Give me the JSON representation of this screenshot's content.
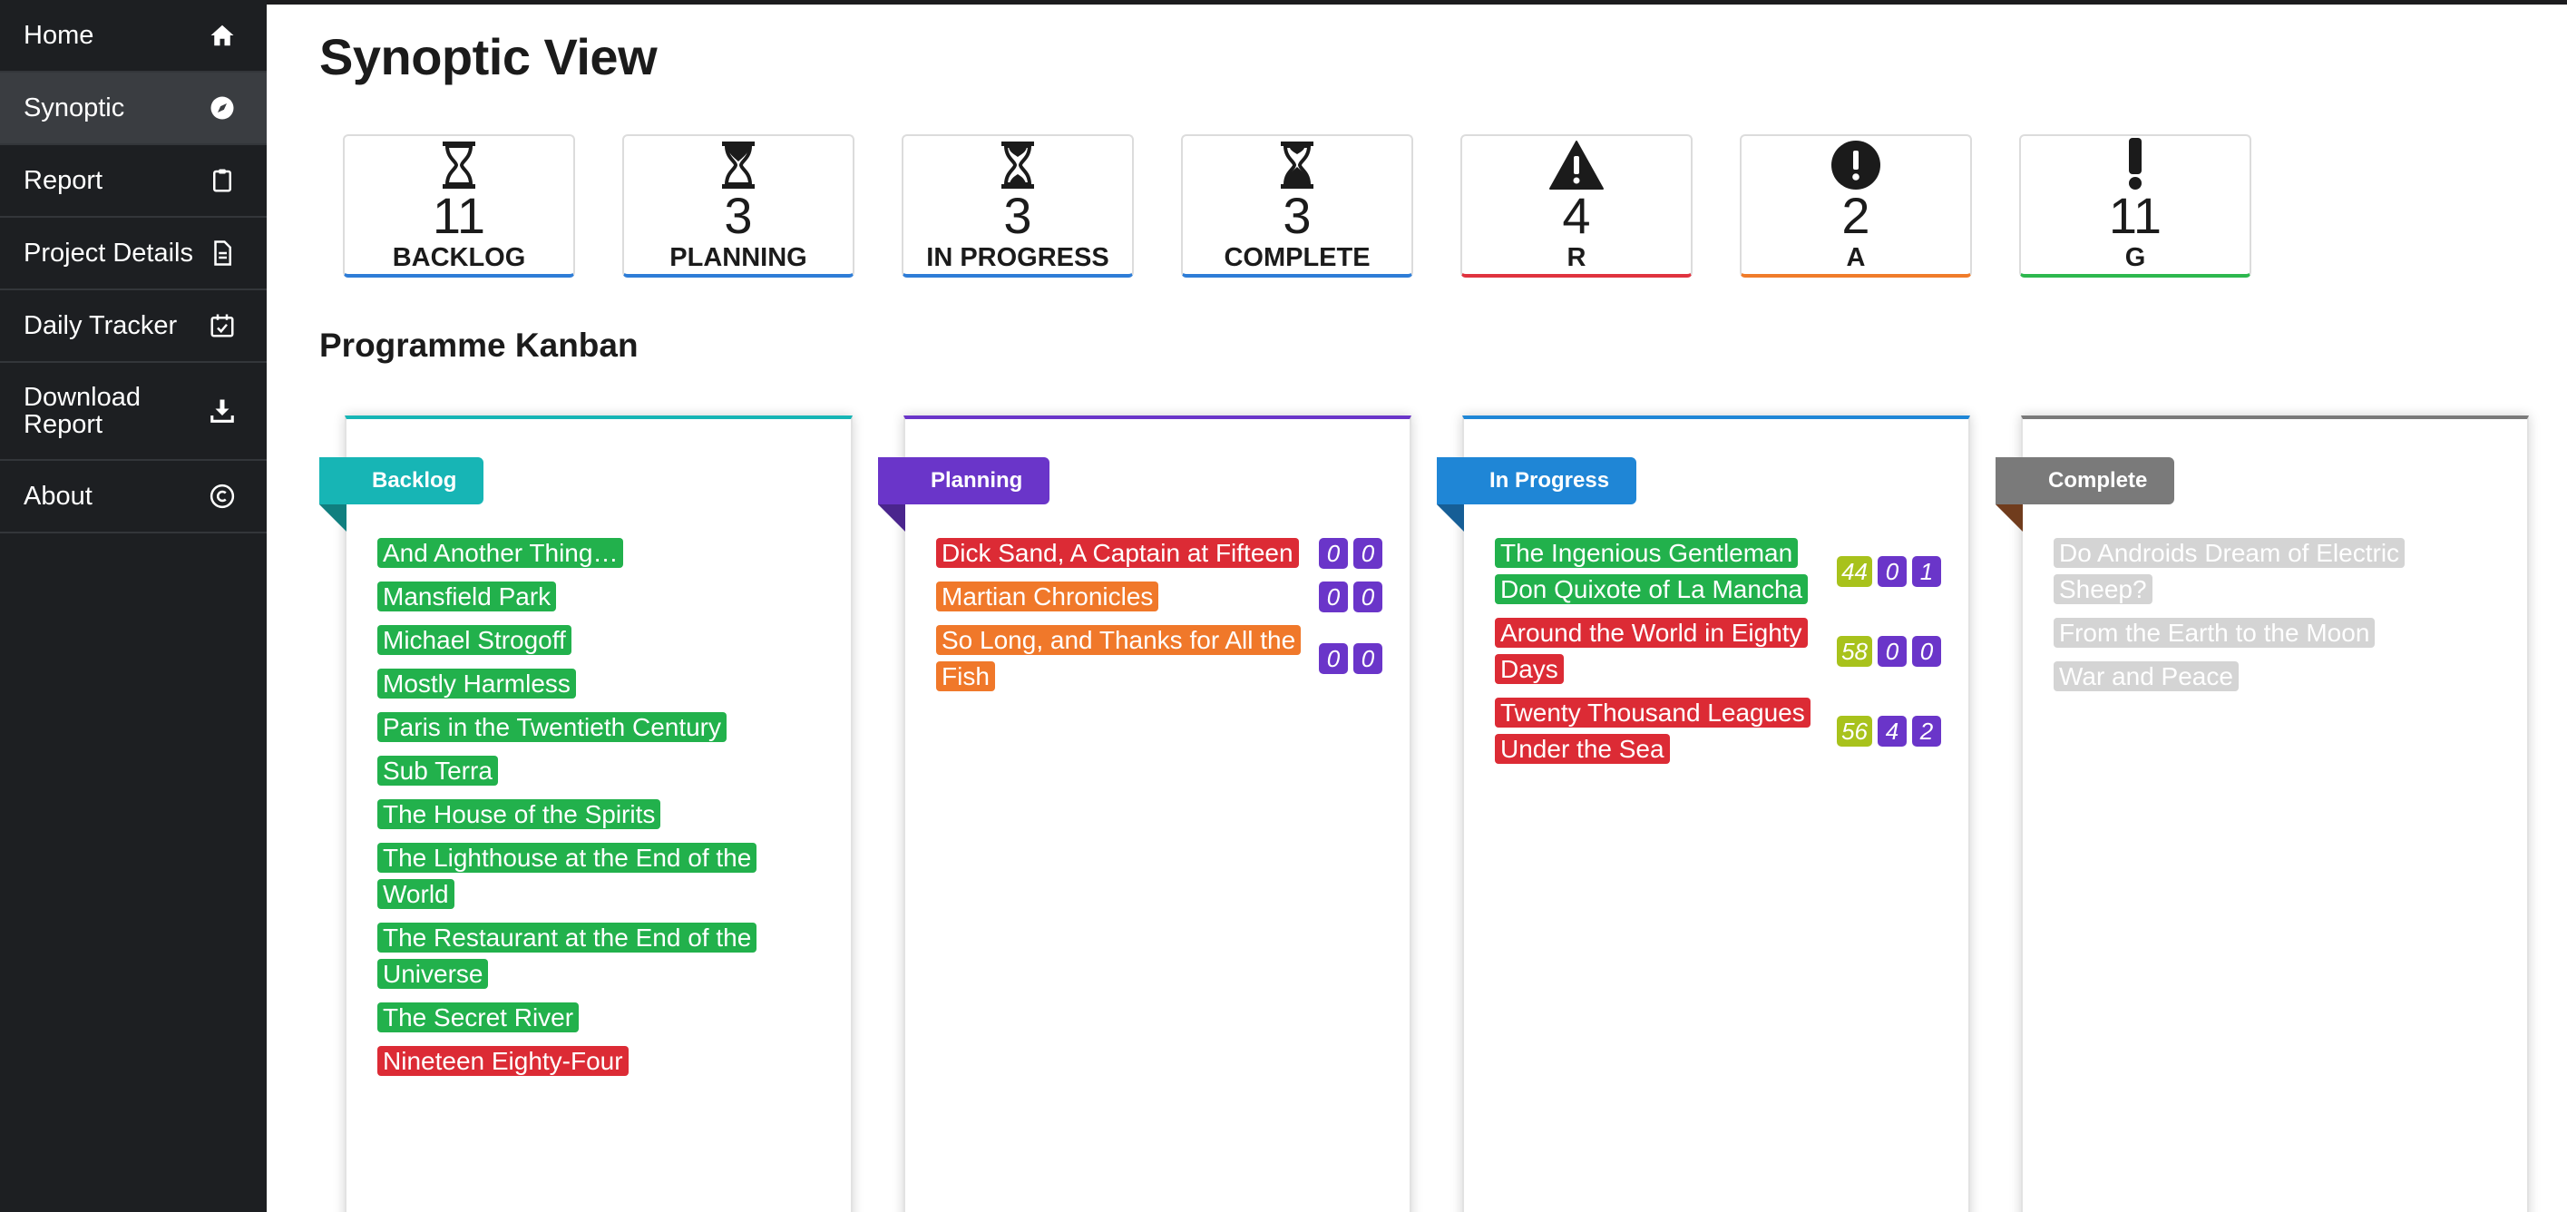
{
  "sidebar": {
    "items": [
      {
        "label": "Home",
        "icon": "home-icon"
      },
      {
        "label": "Synoptic",
        "icon": "compass-icon"
      },
      {
        "label": "Report",
        "icon": "clipboard-icon"
      },
      {
        "label": "Project Details",
        "icon": "document-icon"
      },
      {
        "label": "Daily Tracker",
        "icon": "calendar-check-icon"
      },
      {
        "label": "Download Report",
        "icon": "download-icon"
      },
      {
        "label": "About",
        "icon": "copyright-icon"
      }
    ],
    "active": "Synoptic"
  },
  "page": {
    "title": "Synoptic View",
    "kanban_title": "Programme Kanban"
  },
  "stats": [
    {
      "count": "11",
      "label": "BACKLOG",
      "icon": "hourglass-empty-icon",
      "accent": "#2e7dd7"
    },
    {
      "count": "3",
      "label": "PLANNING",
      "icon": "hourglass-start-icon",
      "accent": "#2e7dd7"
    },
    {
      "count": "3",
      "label": "IN PROGRESS",
      "icon": "hourglass-half-icon",
      "accent": "#2e7dd7"
    },
    {
      "count": "3",
      "label": "COMPLETE",
      "icon": "hourglass-end-icon",
      "accent": "#2e7dd7"
    },
    {
      "count": "4",
      "label": "R",
      "icon": "warning-triangle-icon",
      "accent": "#e0333f"
    },
    {
      "count": "2",
      "label": "A",
      "icon": "exclamation-circle-icon",
      "accent": "#f07c2a"
    },
    {
      "count": "11",
      "label": "G",
      "icon": "exclamation-icon",
      "accent": "#2db84e"
    }
  ],
  "colors": {
    "green": "#22b14c",
    "red": "#dc2b35",
    "orange": "#f0782a",
    "grey": "#d4d4d4",
    "purple": "#6a35c9",
    "olive": "#a8c21c",
    "teal": "#17b5b5",
    "blue": "#1f86d6",
    "dark_grey": "#7a7a7a"
  },
  "kanban": [
    {
      "name": "Backlog",
      "color": "#17b5b5",
      "items": [
        {
          "title": "And Another Thing…",
          "status": "green"
        },
        {
          "title": "Mansfield Park",
          "status": "green"
        },
        {
          "title": "Michael Strogoff",
          "status": "green"
        },
        {
          "title": "Mostly Harmless",
          "status": "green"
        },
        {
          "title": "Paris in the Twentieth Century",
          "status": "green"
        },
        {
          "title": "Sub Terra",
          "status": "green"
        },
        {
          "title": "The House of the Spirits",
          "status": "green"
        },
        {
          "title": "The Lighthouse at the End of the World",
          "status": "green"
        },
        {
          "title": "The Restaurant at the End of the Universe",
          "status": "green"
        },
        {
          "title": "The Secret River",
          "status": "green"
        },
        {
          "title": "Nineteen Eighty-Four",
          "status": "red"
        }
      ]
    },
    {
      "name": "Planning",
      "color": "#6a35c9",
      "items": [
        {
          "title": "Dick Sand, A Captain at Fifteen",
          "status": "red",
          "counts": [
            "0",
            "0"
          ]
        },
        {
          "title": "Martian Chronicles",
          "status": "orange",
          "counts": [
            "0",
            "0"
          ]
        },
        {
          "title": "So Long, and Thanks for All the Fish",
          "status": "orange",
          "counts": [
            "0",
            "0"
          ]
        }
      ]
    },
    {
      "name": "In Progress",
      "color": "#1f86d6",
      "items": [
        {
          "title": "The Ingenious Gentleman Don Quixote of La Mancha",
          "status": "green",
          "progress": "44",
          "counts": [
            "0",
            "1"
          ]
        },
        {
          "title": "Around the World in Eighty Days",
          "status": "red",
          "progress": "58",
          "counts": [
            "0",
            "0"
          ]
        },
        {
          "title": "Twenty Thousand Leagues Under the Sea",
          "status": "red",
          "progress": "56",
          "counts": [
            "4",
            "2"
          ]
        }
      ]
    },
    {
      "name": "Complete",
      "color": "#7a7a7a",
      "items": [
        {
          "title": "Do Androids Dream of Electric Sheep?",
          "status": "grey"
        },
        {
          "title": "From the Earth to the Moon",
          "status": "grey"
        },
        {
          "title": "War and Peace",
          "status": "grey"
        }
      ]
    }
  ]
}
